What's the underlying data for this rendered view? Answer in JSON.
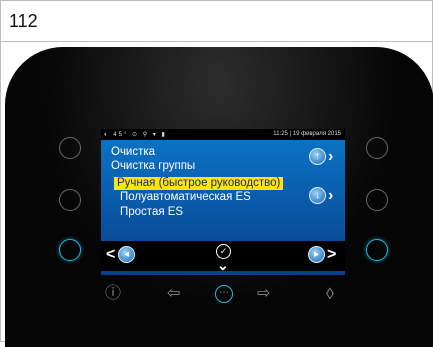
{
  "doc": {
    "page_number": "112"
  },
  "display": {
    "status": {
      "icons": "◐ 45° ⊙ ⚲ ▾ ▮",
      "datetime": "11:25 | 19 февраля 2015"
    },
    "menu": [
      {
        "label": "Очистка",
        "selected": false
      },
      {
        "label": "Очистка группы",
        "selected": false
      },
      {
        "label": "Ручная (быстрое руководство)",
        "selected": true
      },
      {
        "label": "Полуавтоматическая ES",
        "selected": false
      },
      {
        "label": "Простая ES",
        "selected": false
      }
    ],
    "softkeys": {
      "left": "<",
      "center": "✓",
      "right": ">",
      "down": "⌄"
    }
  },
  "bezel": {
    "info_icon": "ⓘ",
    "left_arrow": "⇦",
    "menu_icon": "⋯",
    "right_arrow": "⇨",
    "drop_icon": "◊"
  },
  "colors": {
    "screen_top": "#0b76c8",
    "selection": "#ffe600",
    "accent_ring": "#22b8e0"
  }
}
